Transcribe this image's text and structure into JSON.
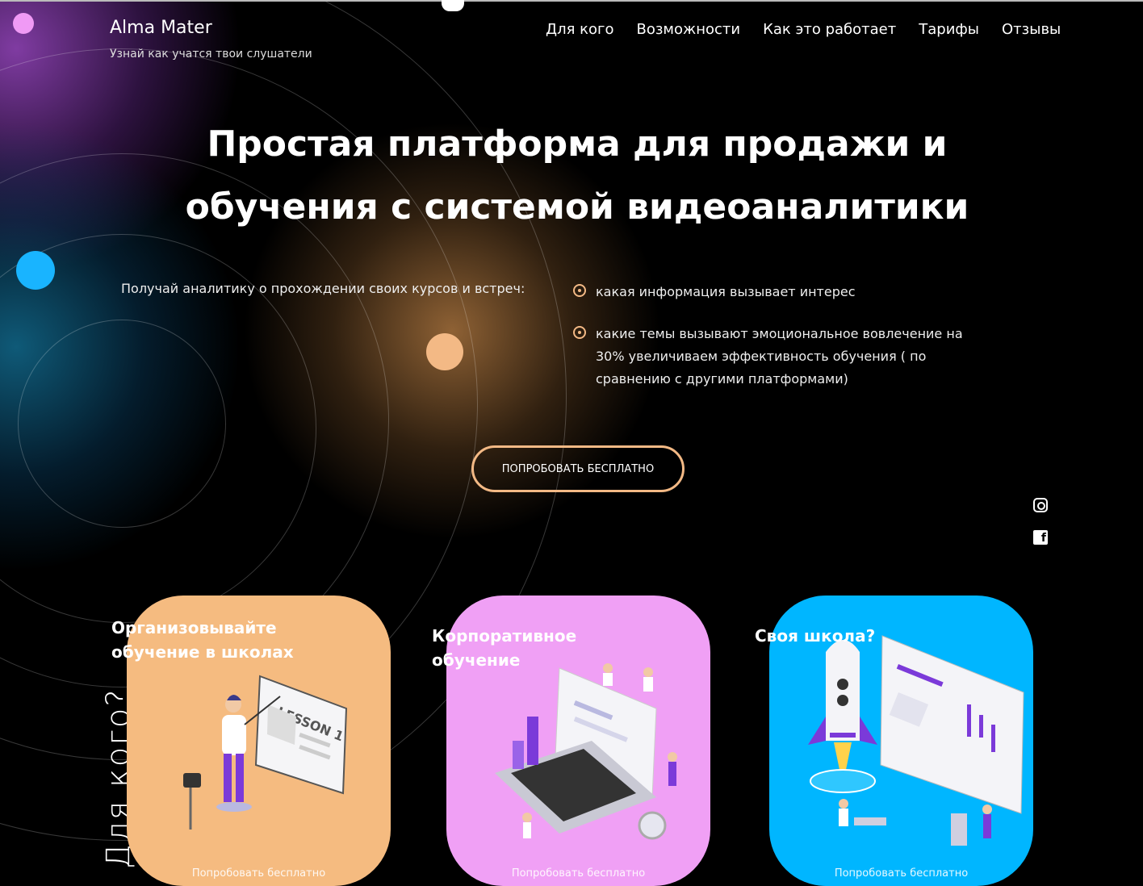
{
  "header": {
    "logo": "Alma Mater",
    "tagline": "Узнай как учатся твои слушатели",
    "nav": [
      "Для кого",
      "Возможности",
      "Как это работает",
      "Тарифы",
      "Отзывы"
    ]
  },
  "hero": {
    "title": "Простая платформа для продажи и обучения с системой видеоаналитики",
    "lead": "Получай аналитику о прохождении своих курсов и встреч:",
    "bullets": [
      "какая информация вызывает интерес",
      "какие темы вызывают эмоциональное вовлечение на 30% увеличиваем эффективность обучения ( по сравнению с другими платформами)"
    ],
    "cta": "ПОПРОБОВАТЬ БЕСПЛАТНО"
  },
  "social": {
    "instagram": "instagram-icon",
    "facebook": "facebook-icon"
  },
  "side_label": "Для кого?",
  "cards": [
    {
      "title": "Организовывайте обучение в школах",
      "cta": "Попробовать бесплатно",
      "color": "#f5bb80",
      "illustration_text": "LESSON 1"
    },
    {
      "title": "Корпоративное обучение",
      "cta": "Попробовать бесплатно",
      "color": "#f0a0f5"
    },
    {
      "title": "Своя школа?",
      "cta": "Попробовать бесплатно",
      "color": "#00b6ff"
    }
  ],
  "colors": {
    "accent": "#f3b985",
    "purple_dot": "#f09af5",
    "blue_dot": "#19b4ff",
    "orange_dot": "#f3b985"
  }
}
